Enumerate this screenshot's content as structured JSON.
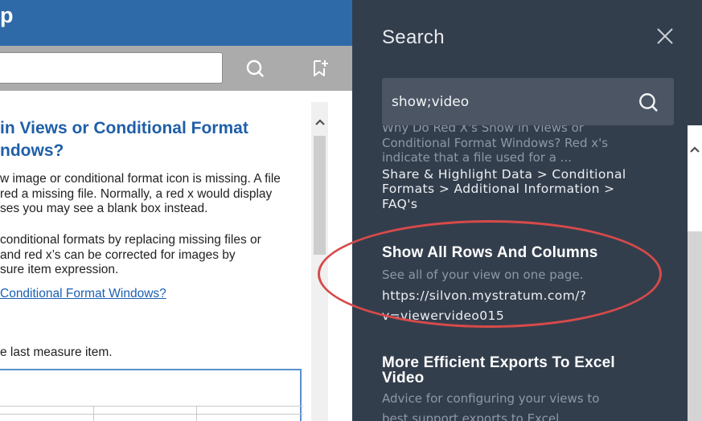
{
  "help": {
    "header_title": "p",
    "search_value": "",
    "article": {
      "title_line1": "in Views or Conditional Format",
      "title_line2": "ndows?",
      "para1": [
        "w image or conditional format icon is missing. A file",
        "red a missing file. Normally, a red x would display",
        "ses you may see a blank box instead."
      ],
      "para2": [
        "conditional formats by replacing missing files or",
        "and red x’s can be corrected for images by",
        "sure item expression."
      ],
      "link": "Conditional Format Windows?",
      "para3": "e last measure item."
    }
  },
  "drawer": {
    "title": "Search",
    "search_value": "show;video",
    "results": [
      {
        "cut_lines": [
          "Why Do Red X's Show in Views or",
          "Conditional Format Windows? Red x's",
          "indicate that a file used for a ..."
        ],
        "path_lines": [
          "Share & Highlight Data > Conditional",
          "Formats > Additional Information >",
          "FAQ's"
        ]
      },
      {
        "title": "Show All Rows And Columns",
        "description": "See all of your view on one page.",
        "url_lines": [
          "https://silvon.mystratum.com/?",
          "v=viewervideo015"
        ]
      },
      {
        "title_lines": [
          "More Efficient Exports To Excel",
          "Video"
        ],
        "description_lines": [
          "Advice for configuring your views to",
          "best support exports to Excel."
        ]
      }
    ]
  },
  "colors": {
    "header_blue": "#2f6aa8",
    "drawer_bg": "#333e4d",
    "search_box_bg": "#4b5563",
    "link_blue": "#1a5fb4",
    "annotation_red": "#d84a4a"
  },
  "icons": {
    "help_search": "search-icon",
    "help_bookmark": "add-bookmark-icon",
    "drawer_close": "close-icon",
    "drawer_search": "search-icon",
    "scroll_up": "chevron-up-icon"
  }
}
